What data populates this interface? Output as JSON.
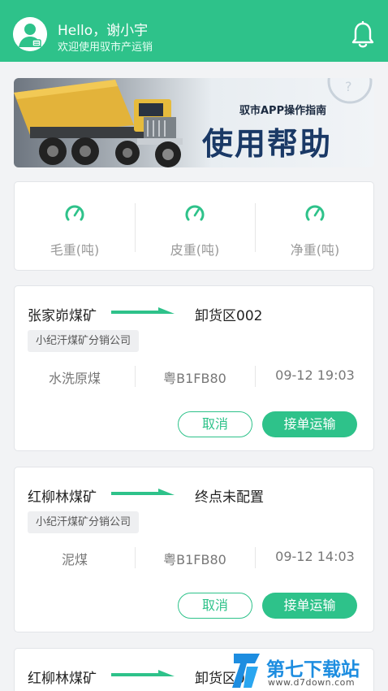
{
  "header": {
    "greeting": "Hello，谢小宇",
    "subtitle": "欢迎使用驭市产运销"
  },
  "banner": {
    "subtitle": "驭市APP操作指南",
    "title": "使用帮助"
  },
  "weights": [
    {
      "label": "毛重(吨)"
    },
    {
      "label": "皮重(吨)"
    },
    {
      "label": "净重(吨)"
    }
  ],
  "orders": [
    {
      "from": "张家峁煤矿",
      "to": "卸货区002",
      "company": "小纪汗煤矿分销公司",
      "cargo": "水洗原煤",
      "plate": "粤B1FB80",
      "time": "09-12 19:03",
      "cancel": "取消",
      "accept": "接单运输"
    },
    {
      "from": "红柳林煤矿",
      "to": "终点未配置",
      "company": "小纪汗煤矿分销公司",
      "cargo": "泥煤",
      "plate": "粤B1FB80",
      "time": "09-12 14:03",
      "cancel": "取消",
      "accept": "接单运输"
    },
    {
      "from": "红柳林煤矿",
      "to": "卸货区0"
    }
  ],
  "watermark": {
    "text": "第七下载站",
    "url": "www.d7down.com"
  },
  "colors": {
    "accent": "#2ec28a",
    "watermark": "#1d8de0"
  }
}
